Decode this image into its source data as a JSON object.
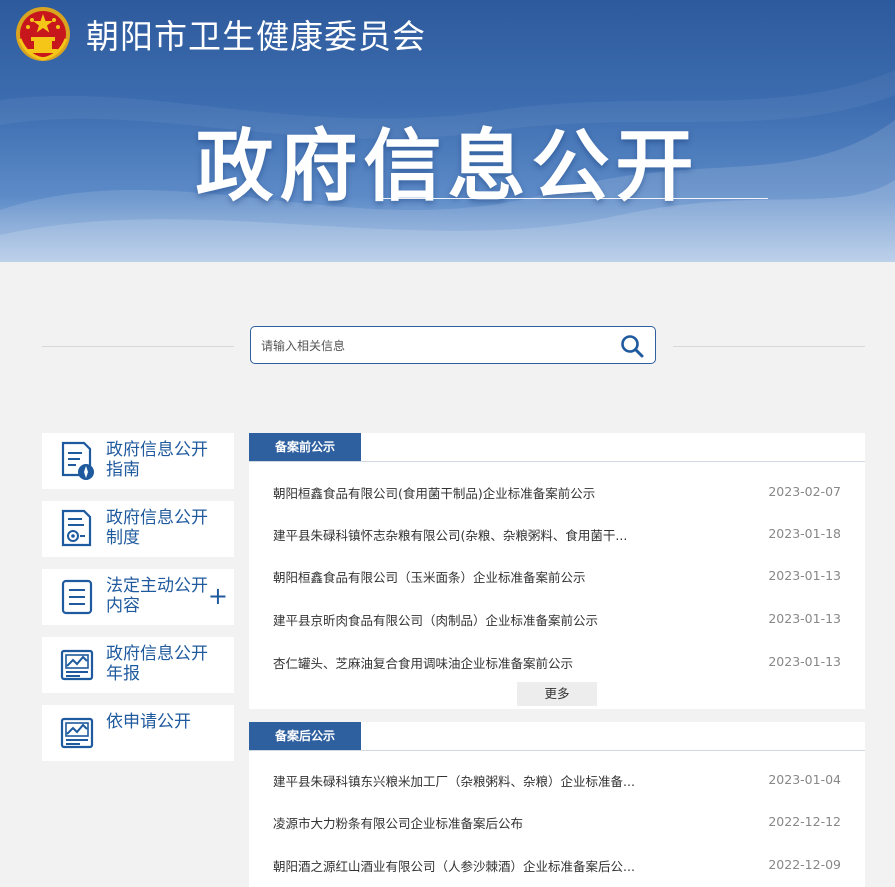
{
  "header": {
    "site_title": "朝阳市卫生健康委员会",
    "hero_title": "政府信息公开",
    "emblem_icon": "national-emblem-icon"
  },
  "search": {
    "placeholder": "请输入相关信息",
    "button_icon": "search-icon"
  },
  "sidebar": {
    "items": [
      {
        "label": "政府信息公开指南",
        "icon": "document-compass-icon",
        "expandable": false
      },
      {
        "label": "政府信息公开制度",
        "icon": "certificate-document-icon",
        "expandable": false
      },
      {
        "label": "法定主动公开内容",
        "icon": "list-document-icon",
        "expandable": true,
        "expand_symbol": "+"
      },
      {
        "label": "政府信息公开年报",
        "icon": "report-chart-icon",
        "expandable": false
      },
      {
        "label": "依申请公开",
        "icon": "report-chart-icon",
        "expandable": false
      }
    ]
  },
  "panels": [
    {
      "tab": "备案前公示",
      "items": [
        {
          "title": "朝阳桓鑫食品有限公司(食用菌干制品)企业标准备案前公示",
          "date": "2023-02-07"
        },
        {
          "title": "建平县朱碌科镇怀志杂粮有限公司(杂粮、杂粮粥料、食用菌干...",
          "date": "2023-01-18"
        },
        {
          "title": "朝阳桓鑫食品有限公司（玉米面条）企业标准备案前公示",
          "date": "2023-01-13"
        },
        {
          "title": "建平县京昕肉食品有限公司（肉制品）企业标准备案前公示",
          "date": "2023-01-13"
        },
        {
          "title": "杏仁罐头、芝麻油复合食用调味油企业标准备案前公示",
          "date": "2023-01-13"
        }
      ],
      "more_label": "更多"
    },
    {
      "tab": "备案后公示",
      "items": [
        {
          "title": "建平县朱碌科镇东兴粮米加工厂（杂粮粥料、杂粮）企业标准备...",
          "date": "2023-01-04"
        },
        {
          "title": "凌源市大力粉条有限公司企业标准备案后公布",
          "date": "2022-12-12"
        },
        {
          "title": "朝阳酒之源红山酒业有限公司（人参沙棘酒）企业标准备案后公...",
          "date": "2022-12-09"
        }
      ]
    }
  ],
  "colors": {
    "brand_blue": "#2e5f9e",
    "banner_top": "#2d5a9c",
    "page_bg": "#f2f2f2"
  }
}
